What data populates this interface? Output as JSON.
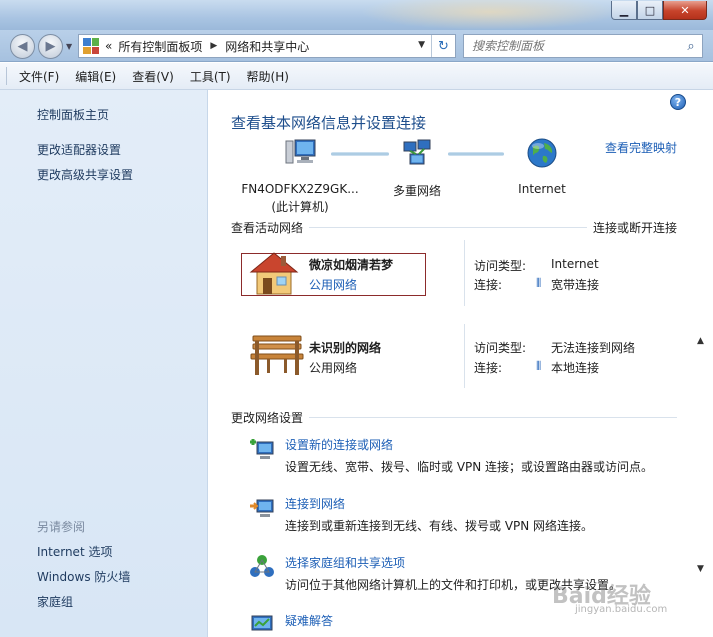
{
  "window": {
    "minimize_glyph": "▁",
    "maximize_glyph": "□",
    "close_glyph": "✕"
  },
  "navigation": {
    "breadcrumb_chevron": "«",
    "breadcrumbs": [
      "所有控制面板项",
      "网络和共享中心"
    ],
    "breadcrumb_separator": "▶",
    "dropdown_glyph": "▼",
    "refresh_glyph": "↻",
    "search_placeholder": "搜索控制面板",
    "search_glyph": "⌕"
  },
  "menu": {
    "items": [
      "文件(F)",
      "编辑(E)",
      "查看(V)",
      "工具(T)",
      "帮助(H)"
    ]
  },
  "sidebar": {
    "items": [
      "控制面板主页",
      "更改适配器设置",
      "更改高级共享设置"
    ],
    "see_also_title": "另请参阅",
    "see_also": [
      "Internet 选项",
      "Windows 防火墙",
      "家庭组"
    ]
  },
  "main": {
    "help_glyph": "?",
    "title": "查看基本网络信息并设置连接",
    "full_map_link": "查看完整映射",
    "map": {
      "computer_name": "FN4ODFKX2Z9GK...",
      "computer_sub": "(此计算机)",
      "middle_label": "多重网络",
      "internet_label": "Internet"
    },
    "active_networks_label": "查看活动网络",
    "connect_disconnect_link": "连接或断开连接",
    "networks": [
      {
        "name": "微凉如烟清若梦",
        "type": "公用网络",
        "access_type_label": "访问类型:",
        "access_type_value": "Internet",
        "connection_label": "连接:",
        "connection_value": "宽带连接"
      },
      {
        "name": "未识别的网络",
        "type": "公用网络",
        "access_type_label": "访问类型:",
        "access_type_value": "无法连接到网络",
        "connection_label": "连接:",
        "connection_value": "本地连接"
      }
    ],
    "change_settings_label": "更改网络设置",
    "tasks": [
      {
        "title": "设置新的连接或网络",
        "desc": "设置无线、宽带、拨号、临时或 VPN 连接；或设置路由器或访问点。"
      },
      {
        "title": "连接到网络",
        "desc": "连接到或重新连接到无线、有线、拨号或 VPN 网络连接。"
      },
      {
        "title": "选择家庭组和共享选项",
        "desc": "访问位于其他网络计算机上的文件和打印机，或更改共享设置。"
      },
      {
        "title": "疑难解答",
        "desc": ""
      }
    ]
  },
  "watermark": {
    "text": "Baid经验",
    "sub": "jingyan.baidu.com"
  }
}
